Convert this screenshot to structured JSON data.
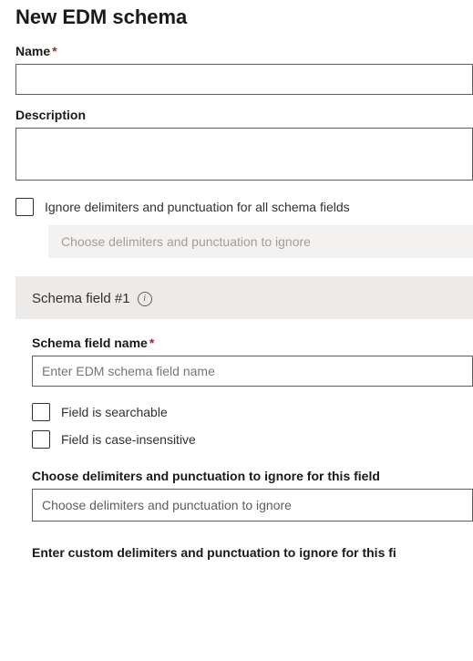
{
  "page_title": "New EDM schema",
  "name": {
    "label": "Name",
    "value": ""
  },
  "description": {
    "label": "Description",
    "value": ""
  },
  "ignore_all": {
    "label": "Ignore delimiters and punctuation for all schema fields",
    "checked": false,
    "dropdown_placeholder": "Choose delimiters and punctuation to ignore"
  },
  "schema_field_section": {
    "title": "Schema field #1",
    "field_name": {
      "label": "Schema field name",
      "placeholder": "Enter EDM schema field name",
      "value": ""
    },
    "searchable": {
      "label": "Field is searchable",
      "checked": false
    },
    "case_insensitive": {
      "label": "Field is case-insensitive",
      "checked": false
    },
    "choose_ignore": {
      "label": "Choose delimiters and punctuation to ignore for this field",
      "placeholder": "Choose delimiters and punctuation to ignore"
    },
    "custom_ignore": {
      "label": "Enter custom delimiters and punctuation to ignore for this fi"
    }
  }
}
